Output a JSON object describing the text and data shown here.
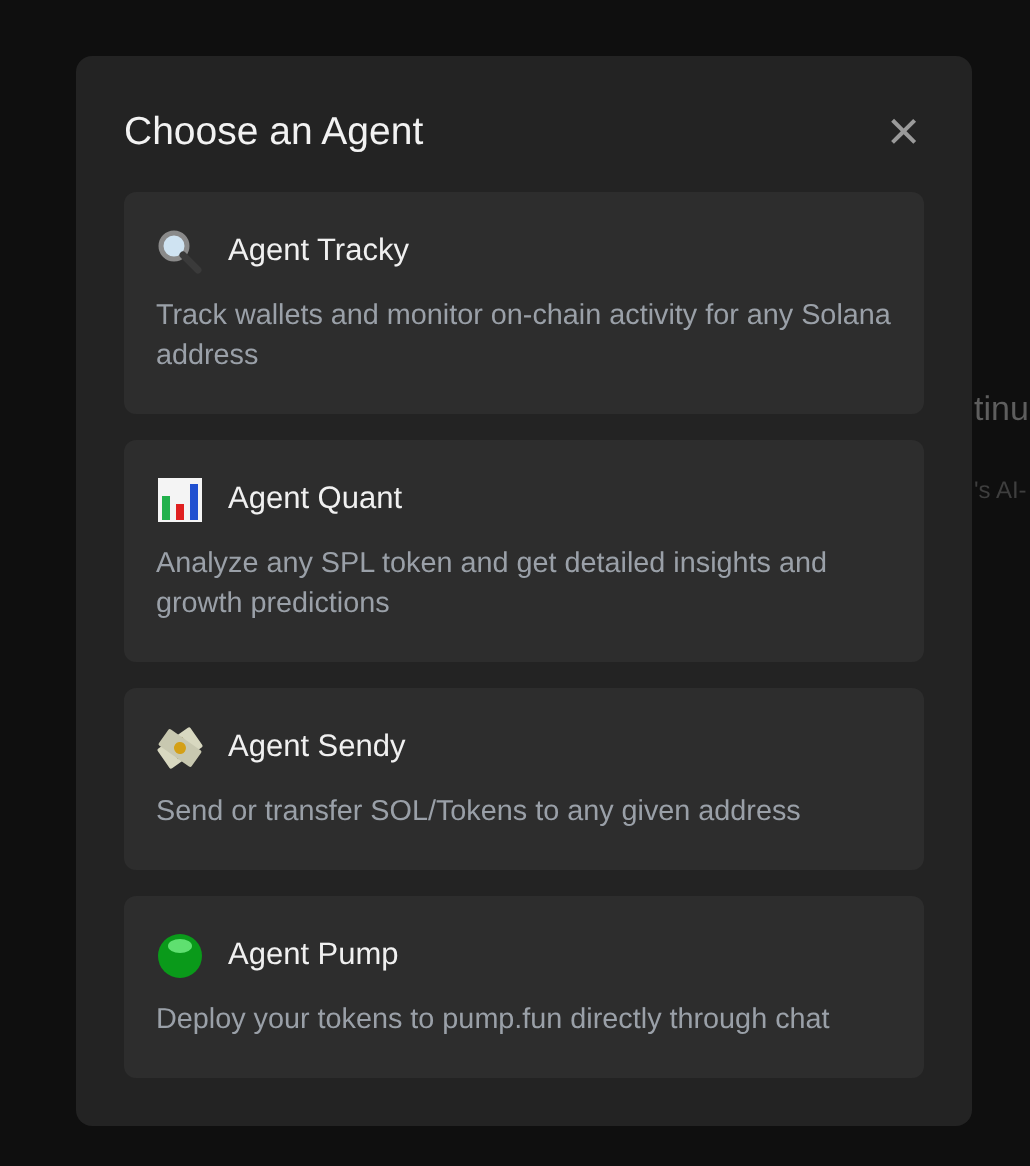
{
  "background": {
    "heading": "tinu",
    "subtitle": "'s AI-"
  },
  "modal": {
    "title": "Choose an Agent",
    "close": "×",
    "agents": [
      {
        "kind": "magnifier",
        "name": "Agent Tracky",
        "description": "Track wallets and monitor on-chain activity for any Solana address"
      },
      {
        "kind": "chart",
        "name": "Agent Quant",
        "description": "Analyze any SPL token and get detailed insights and growth predictions"
      },
      {
        "kind": "money",
        "name": "Agent Sendy",
        "description": "Send or transfer SOL/Tokens to any given address"
      },
      {
        "kind": "ball",
        "name": "Agent Pump",
        "description": "Deploy your tokens to pump.fun directly through chat"
      }
    ]
  }
}
